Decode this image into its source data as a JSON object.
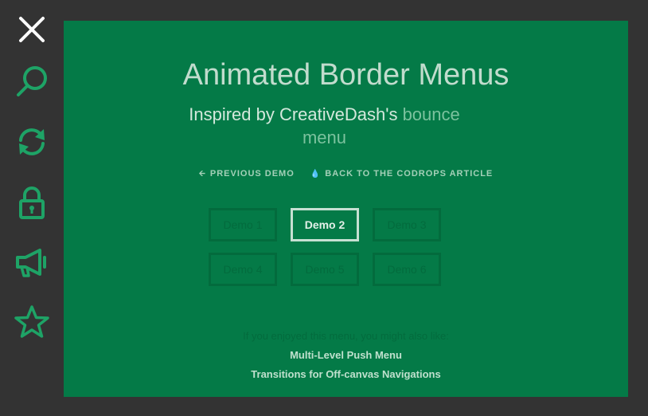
{
  "side_menu": {
    "items": [
      {
        "icon": "close-icon",
        "color": "#ffffff"
      },
      {
        "icon": "search-icon",
        "color": "#1ea366"
      },
      {
        "icon": "refresh-icon",
        "color": "#1ea366"
      },
      {
        "icon": "lock-icon",
        "color": "#1ea366"
      },
      {
        "icon": "megaphone-icon",
        "color": "#1ea366"
      },
      {
        "icon": "star-icon",
        "color": "#1ea366"
      }
    ]
  },
  "header": {
    "title": "Animated Border Menus",
    "subtitle_prefix": "Inspired by CreativeDash's ",
    "subtitle_link": "bounce menu"
  },
  "nav": {
    "previous_demo": "PREVIOUS DEMO",
    "back_to_article": "BACK TO THE CODROPS ARTICLE"
  },
  "demos": [
    {
      "label": "Demo 1",
      "active": false
    },
    {
      "label": "Demo 2",
      "active": true
    },
    {
      "label": "Demo 3",
      "active": false
    },
    {
      "label": "Demo 4",
      "active": false
    },
    {
      "label": "Demo 5",
      "active": false
    },
    {
      "label": "Demo 6",
      "active": false
    }
  ],
  "related": {
    "intro": "If you enjoyed this menu, you might also like:",
    "links": [
      "Multi-Level Push Menu",
      "Transitions for Off-canvas Navigations"
    ]
  },
  "colors": {
    "background": "#333333",
    "panel": "#047a47",
    "icon_accent": "#1ea366"
  }
}
